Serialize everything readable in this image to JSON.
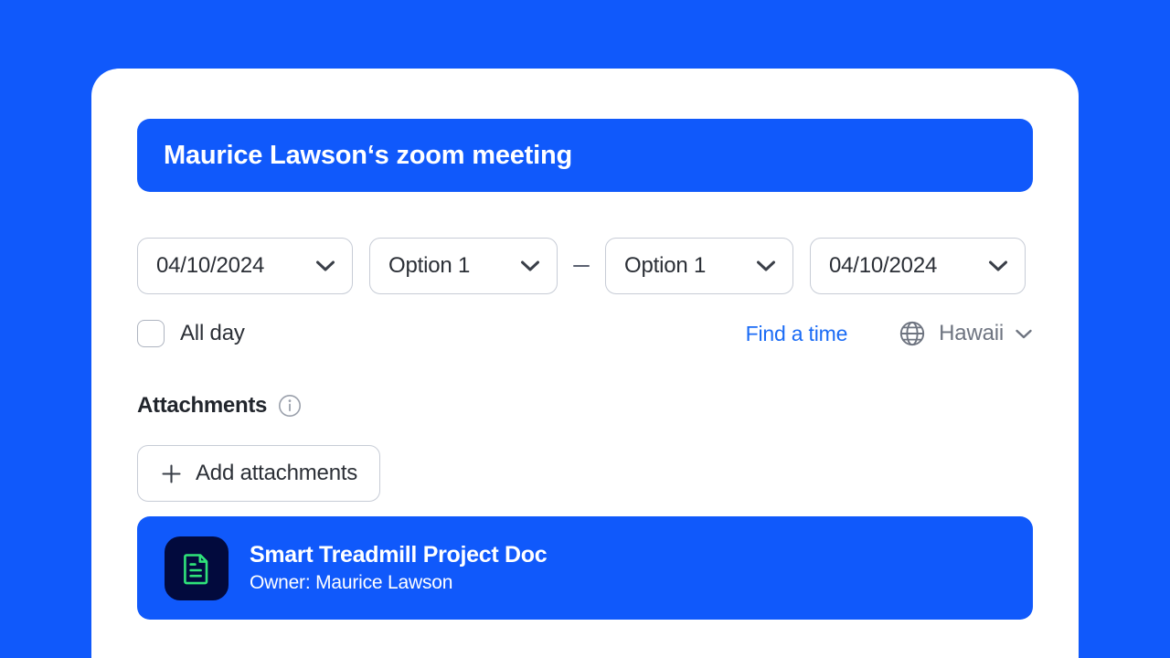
{
  "theme": {
    "background_blue": "#1059fb",
    "card_white": "#ffffff",
    "link_blue": "#1a6bf5",
    "border_gray": "#c7ccd6",
    "text_dark": "#2b2f36",
    "text_muted": "#6e7480",
    "file_icon_bg": "#020a3d",
    "file_icon_green": "#2fe37a"
  },
  "meeting": {
    "title": "Maurice Lawson‘s zoom meeting"
  },
  "schedule": {
    "start_date": "04/10/2024",
    "start_time": "Option 1",
    "range_separator": "—",
    "end_time": "Option 1",
    "end_date": "04/10/2024",
    "all_day_label": "All day",
    "all_day_checked": false,
    "find_a_time_label": "Find a time",
    "timezone": "Hawaii",
    "icons": {
      "chevron": "chevron-down-icon",
      "globe": "globe-icon"
    }
  },
  "attachments": {
    "section_title": "Attachments",
    "info_icon": "info-icon",
    "add_button_label": "Add attachments",
    "add_button_icon": "plus-icon",
    "items": [
      {
        "name": "Smart Treadmill Project Doc",
        "owner": "Owner: Maurice Lawson",
        "icon": "document-file-icon"
      }
    ]
  }
}
